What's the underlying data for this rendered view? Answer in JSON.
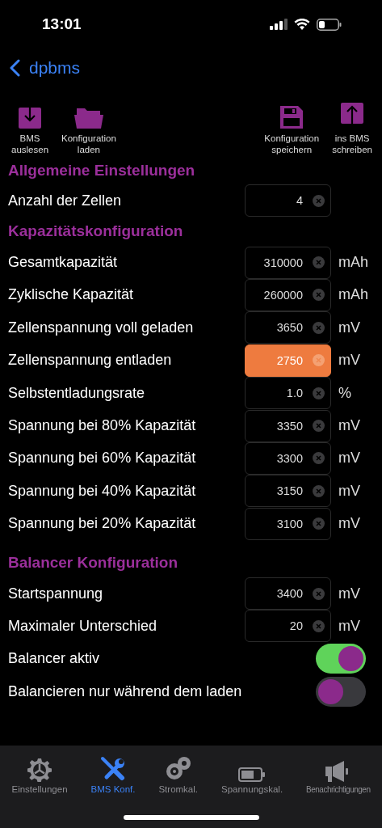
{
  "status_bar": {
    "time": "13:01"
  },
  "nav": {
    "back_label": "dpbms"
  },
  "toolbar": [
    {
      "label": "BMS\nauslesen"
    },
    {
      "label": "Konfiguration\nladen"
    },
    {
      "label": "Konfiguration\nspeichern"
    },
    {
      "label": "ins BMS\nschreiben"
    }
  ],
  "sections": [
    {
      "title": "Allgemeine Einstellungen",
      "rows": [
        {
          "kind": "field",
          "label": "Anzahl der Zellen",
          "value": "4",
          "highlighted": false
        }
      ]
    },
    {
      "title": "Kapazitätskonfiguration",
      "rows": [
        {
          "kind": "field",
          "label": "Gesamtkapazität",
          "value": "310000",
          "unit": "mAh",
          "highlighted": false
        },
        {
          "kind": "field",
          "label": "Zyklische Kapazität",
          "value": "260000",
          "unit": "mAh",
          "highlighted": false
        },
        {
          "kind": "field",
          "label": "Zellenspannung voll geladen",
          "value": "3650",
          "unit": "mV",
          "highlighted": false
        },
        {
          "kind": "field",
          "label": "Zellenspannung entladen",
          "value": "2750",
          "unit": "mV",
          "highlighted": true
        },
        {
          "kind": "field",
          "label": "Selbstentladungsrate",
          "value": "1.0",
          "unit": "%",
          "highlighted": false
        },
        {
          "kind": "field",
          "label": "Spannung bei 80% Kapazität",
          "value": "3350",
          "unit": "mV",
          "highlighted": false
        },
        {
          "kind": "field",
          "label": "Spannung bei 60% Kapazität",
          "value": "3300",
          "unit": "mV",
          "highlighted": false
        },
        {
          "kind": "field",
          "label": "Spannung bei 40% Kapazität",
          "value": "3150",
          "unit": "mV",
          "highlighted": false
        },
        {
          "kind": "field",
          "label": "Spannung bei 20% Kapazität",
          "value": "3100",
          "unit": "mV",
          "highlighted": false
        }
      ]
    },
    {
      "title": "Balancer Konfiguration",
      "rows": [
        {
          "kind": "field",
          "label": "Startspannung",
          "value": "3400",
          "unit": "mV",
          "highlighted": false
        },
        {
          "kind": "field",
          "label": "Maximaler Unterschied",
          "value": "20",
          "unit": "mV",
          "highlighted": false
        },
        {
          "kind": "toggle",
          "label": "Balancer aktiv",
          "on": true
        },
        {
          "kind": "toggle",
          "label": "Balancieren nur während dem laden",
          "on": false
        }
      ]
    }
  ],
  "tab_bar": [
    {
      "label": "Einstellungen",
      "selected": false
    },
    {
      "label": "BMS Konf.",
      "selected": true
    },
    {
      "label": "Stromkal.",
      "selected": false
    },
    {
      "label": "Spannungskal.",
      "selected": false
    },
    {
      "label": "Benachrichtigungen",
      "selected": false
    }
  ]
}
